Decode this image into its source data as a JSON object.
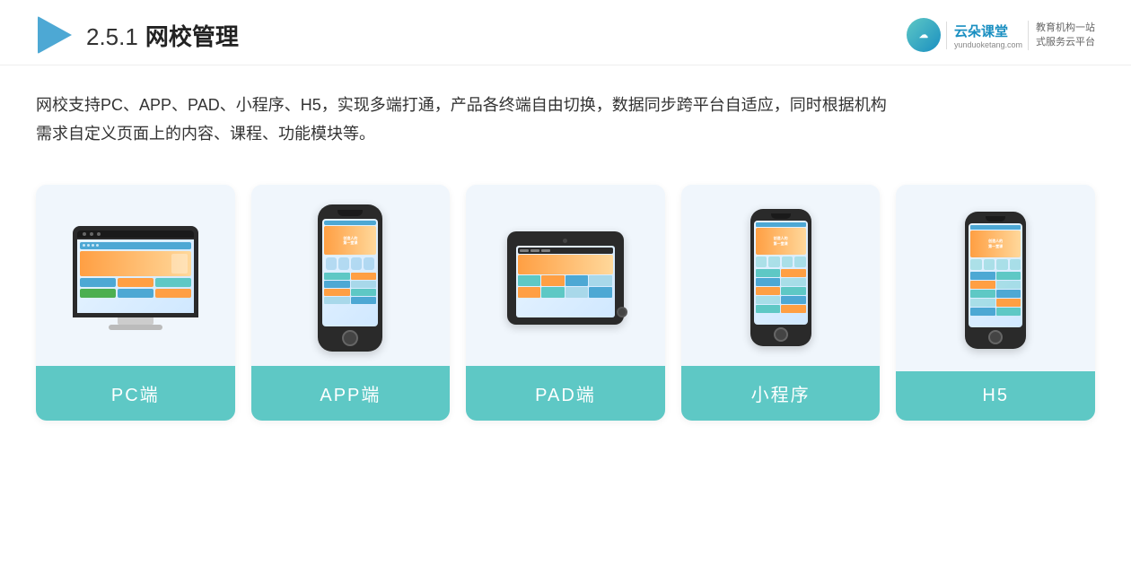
{
  "header": {
    "title_number": "2.5.1",
    "title_main": "网校管理",
    "logo_brand": "云朵课堂",
    "logo_domain": "yunduoketang.com",
    "logo_slogan_line1": "教育机构一站",
    "logo_slogan_line2": "式服务云平台"
  },
  "description": {
    "text_line1": "网校支持PC、APP、PAD、小程序、H5，实现多端打通，产品各终端自由切换，数据同步跨平台自适应，同时根据机构",
    "text_line2": "需求自定义页面上的内容、课程、功能模块等。"
  },
  "cards": [
    {
      "id": "pc",
      "label": "PC端"
    },
    {
      "id": "app",
      "label": "APP端"
    },
    {
      "id": "pad",
      "label": "PAD端"
    },
    {
      "id": "miniprogram",
      "label": "小程序"
    },
    {
      "id": "h5",
      "label": "H5"
    }
  ]
}
